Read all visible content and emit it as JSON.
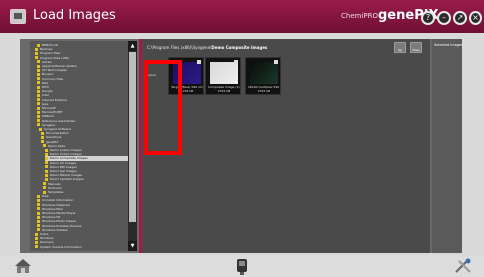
{
  "window": {
    "title": "Load Images",
    "brand_small": "ChemiPRO",
    "brand_big": "genePIX",
    "controls": {
      "help": "?",
      "minimize": "–",
      "maximize": "↗",
      "close": "×"
    }
  },
  "tree": {
    "nodes": [
      {
        "label": "BENCH Lib"
      },
      {
        "label": "Backups"
      },
      {
        "label": "Program Files"
      },
      {
        "label": "Program Files (x86)"
      },
      {
        "label": "Adobe"
      },
      {
        "label": "Apple Software Update"
      },
      {
        "label": "ATI Technologies"
      },
      {
        "label": "Bonjour"
      },
      {
        "label": "Common Files"
      },
      {
        "label": "Dell"
      },
      {
        "label": "DIFX"
      },
      {
        "label": "Google"
      },
      {
        "label": "Intel"
      },
      {
        "label": "Internet Explorer"
      },
      {
        "label": "Java"
      },
      {
        "label": "Microsoft"
      },
      {
        "label": "Microsoft.NET"
      },
      {
        "label": "MSBuild"
      },
      {
        "label": "Reference Assemblies"
      },
      {
        "label": "Syngene"
      },
      {
        "label": "Syngene Software"
      },
      {
        "label": "Documentation"
      },
      {
        "label": "GeneTools"
      },
      {
        "label": "genePIX"
      },
      {
        "label": "Demo Data"
      },
      {
        "label": "Demo Colour Images"
      },
      {
        "label": "Demo Colour Images"
      },
      {
        "label": "Demo Composite Images",
        "selected": true
      },
      {
        "label": "Demo UV Images"
      },
      {
        "label": "Demo BW Images"
      },
      {
        "label": "Demo Gel Images"
      },
      {
        "label": "Demo Marker Images"
      },
      {
        "label": "Demo Spotted Images"
      },
      {
        "label": "Manuals"
      },
      {
        "label": "Protocols"
      },
      {
        "label": "Templates"
      },
      {
        "label": "Help"
      },
      {
        "label": "Uninstall Information"
      },
      {
        "label": "Windows Defender"
      },
      {
        "label": "Windows Mail"
      },
      {
        "label": "Windows Media Player"
      },
      {
        "label": "Windows NT"
      },
      {
        "label": "Windows Photo Viewer"
      },
      {
        "label": "Windows Portable Devices"
      },
      {
        "label": "Windows Sidebar"
      },
      {
        "label": "Users"
      },
      {
        "label": "Windows"
      },
      {
        "label": "Recovery"
      },
      {
        "label": "System Volume Information"
      }
    ]
  },
  "content": {
    "path_prefix": "C:\\Program Files (x86)\\Syngene\\",
    "path_current": "Demo Composite Images",
    "toolbar": {
      "up_label": "Up",
      "view_label": "View"
    },
    "first_label": "Loaded",
    "thumbnails": [
      {
        "name": "Target (Blue) 590 nm",
        "size": "1234 kB",
        "colors": [
          "#1b1060",
          "#2b1a8a"
        ]
      },
      {
        "name": "Composite Image (1).sgd",
        "size": "4315 kB",
        "colors": [
          "#d8d8d8",
          "#efefef"
        ]
      },
      {
        "name": "16160 multiplex 590 composite.sgd",
        "size": "4315 kB",
        "colors": [
          "#0a0a0a",
          "#1a3a2a"
        ]
      }
    ]
  },
  "right_panel": {
    "label": "Selected Images"
  },
  "bottom": {
    "home": "home-icon",
    "device": "device-icon",
    "tools": "tools-icon"
  }
}
